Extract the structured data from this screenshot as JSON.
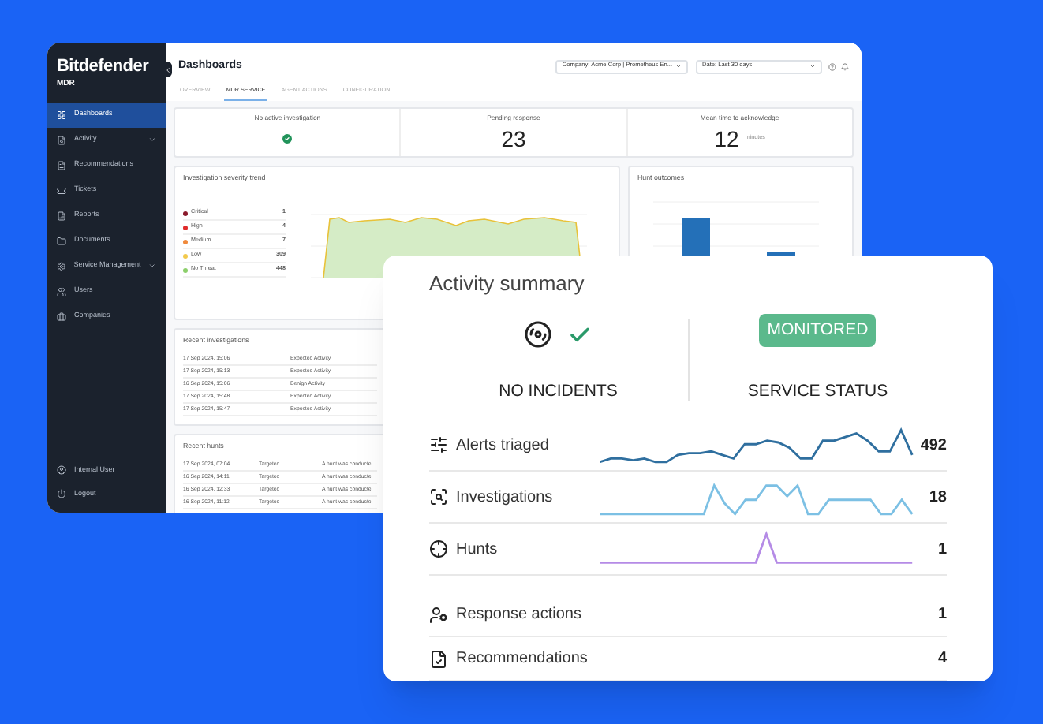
{
  "sidebar": {
    "brand": "Bitdefender",
    "brand_sub": "MDR",
    "items": [
      {
        "label": "Dashboards",
        "selected": true,
        "expandable": false
      },
      {
        "label": "Activity",
        "selected": false,
        "expandable": true
      },
      {
        "label": "Recommendations",
        "selected": false,
        "expandable": false
      },
      {
        "label": "Tickets",
        "selected": false,
        "expandable": false
      },
      {
        "label": "Reports",
        "selected": false,
        "expandable": false
      },
      {
        "label": "Documents",
        "selected": false,
        "expandable": false
      },
      {
        "label": "Service Management",
        "selected": false,
        "expandable": true
      },
      {
        "label": "Users",
        "selected": false,
        "expandable": false
      },
      {
        "label": "Companies",
        "selected": false,
        "expandable": false
      }
    ],
    "footer": [
      {
        "label": "Internal User"
      },
      {
        "label": "Logout"
      }
    ]
  },
  "header": {
    "title": "Dashboards",
    "company": "Company: Acme Corp | Prometheus En...",
    "date": "Date: Last 30 days"
  },
  "tabs": [
    {
      "label": "OVERVIEW",
      "selected": false
    },
    {
      "label": "MDR SERVICE",
      "selected": true
    },
    {
      "label": "AGENT ACTIONS",
      "selected": false
    },
    {
      "label": "CONFIGURATION",
      "selected": false
    }
  ],
  "stats": [
    {
      "kind": "check",
      "label": "No active investigation"
    },
    {
      "kind": "number",
      "label": "Pending response",
      "value": "23"
    },
    {
      "kind": "number",
      "label": "Mean time to acknowledge",
      "value": "12",
      "unit": "minutes"
    }
  ],
  "severity_trend": {
    "title": "Investigation severity trend",
    "legend": [
      {
        "label": "Critical",
        "value": "1",
        "color": "#8b1a2b"
      },
      {
        "label": "High",
        "value": "4",
        "color": "#e02b2b"
      },
      {
        "label": "Medium",
        "value": "7",
        "color": "#f08a3c"
      },
      {
        "label": "Low",
        "value": "309",
        "color": "#f2c94c"
      },
      {
        "label": "No Threat",
        "value": "448",
        "color": "#8ccf6b"
      }
    ]
  },
  "hunt_outcomes": {
    "title": "Hunt outcomes"
  },
  "recent_investigations": {
    "title": "Recent investigations",
    "rows": [
      {
        "date": "17 Sep 2024, 15:06",
        "type": "Expected Activity"
      },
      {
        "date": "17 Sep 2024, 15:13",
        "type": "Expected Activity"
      },
      {
        "date": "16 Sep 2024, 15:06",
        "type": "Benign Activity"
      },
      {
        "date": "17 Sep 2024, 15:48",
        "type": "Expected Activity"
      },
      {
        "date": "17 Sep 2024, 15:47",
        "type": "Expected Activity"
      }
    ]
  },
  "recent_hunts": {
    "title": "Recent hunts",
    "rows": [
      {
        "date": "17 Sep 2024, 07:04",
        "type": "Targeted",
        "description": "A hunt was conducte"
      },
      {
        "date": "16 Sep 2024, 14:11",
        "type": "Targeted",
        "description": "A hunt was conducte"
      },
      {
        "date": "16 Sep 2024, 12:33",
        "type": "Targeted",
        "description": "A hunt was conducte"
      },
      {
        "date": "16 Sep 2024, 11:12",
        "type": "Targeted",
        "description": "A hunt was conducte"
      }
    ]
  },
  "activity_summary": {
    "title": "Activity summary",
    "incidents_label": "NO INCIDENTS",
    "status_badge": "MONITORED",
    "status_label": "SERVICE STATUS",
    "rows": [
      {
        "kind": "trend",
        "label": "Alerts triaged",
        "value": "492",
        "color": "#2f6f9f"
      },
      {
        "kind": "trend",
        "label": "Investigations",
        "value": "18",
        "color": "#7cc0e4"
      },
      {
        "kind": "trend",
        "label": "Hunts",
        "value": "1",
        "color": "#b58be6"
      },
      {
        "kind": "count",
        "label": "Response actions",
        "value": "1"
      },
      {
        "kind": "count",
        "label": "Recommendations",
        "value": "4"
      }
    ]
  }
}
